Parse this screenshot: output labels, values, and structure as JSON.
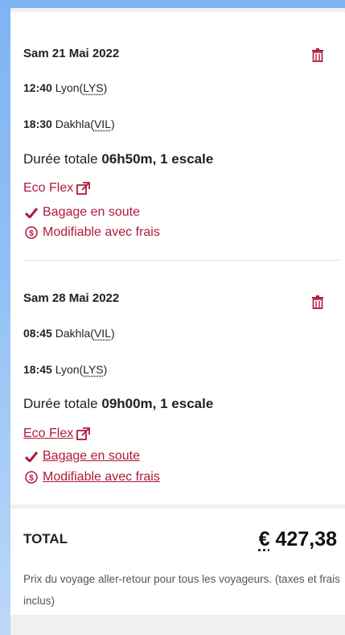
{
  "segments": [
    {
      "date": "Sam 21 Mai 2022",
      "depart_time": "12:40",
      "depart_city": "Lyon",
      "depart_code": "LYS",
      "arrive_time": "18:30",
      "arrive_city": "Dakhla",
      "arrive_code": "VIL",
      "duration_label": "Durée totale",
      "duration_value": "06h50m, 1 escale",
      "fare": "Eco Flex",
      "features": [
        "Bagage en soute",
        "Modifiable avec frais"
      ]
    },
    {
      "date": "Sam 28 Mai 2022",
      "depart_time": "08:45",
      "depart_city": "Dakhla",
      "depart_code": "VIL",
      "arrive_time": "18:45",
      "arrive_city": "Lyon",
      "arrive_code": "LYS",
      "duration_label": "Durée totale",
      "duration_value": "09h00m, 1 escale",
      "fare": "Eco Flex",
      "features": [
        "Bagage en soute",
        "Modifiable avec frais"
      ]
    }
  ],
  "total": {
    "label": "TOTAL",
    "currency": "€",
    "amount": "427,38",
    "description": "Prix du voyage aller-retour pour tous les voyageurs. (taxes et frais inclus)"
  },
  "colors": {
    "accent": "#b0193a",
    "background": "#8fbff5"
  }
}
